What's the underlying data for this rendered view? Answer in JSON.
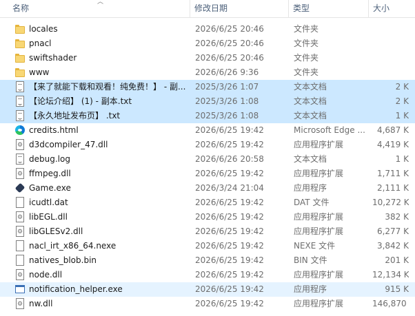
{
  "columns": {
    "name": "名称",
    "date": "修改日期",
    "type": "类型",
    "size": "大小"
  },
  "files": [
    {
      "name": "locales",
      "date": "2026/6/25 20:46",
      "type": "文件夹",
      "size": "",
      "icon": "folder-icon",
      "state": ""
    },
    {
      "name": "pnacl",
      "date": "2026/6/25 20:46",
      "type": "文件夹",
      "size": "",
      "icon": "folder-icon",
      "state": ""
    },
    {
      "name": "swiftshader",
      "date": "2026/6/25 20:46",
      "type": "文件夹",
      "size": "",
      "icon": "folder-icon",
      "state": ""
    },
    {
      "name": "www",
      "date": "2026/6/26 9:36",
      "type": "文件夹",
      "size": "",
      "icon": "folder-icon",
      "state": ""
    },
    {
      "name": "【来了就能下载和观看！纯免费！】 - 副...",
      "date": "2025/3/26 1:07",
      "type": "文本文档",
      "size": "2 K",
      "icon": "text-file-icon",
      "state": "selected"
    },
    {
      "name": "【论坛介绍】 (1) - 副本.txt",
      "date": "2025/3/26 1:08",
      "type": "文本文档",
      "size": "2 K",
      "icon": "text-file-icon",
      "state": "selected"
    },
    {
      "name": "【永久地址发布页】 .txt",
      "date": "2025/3/26 1:08",
      "type": "文本文档",
      "size": "1 K",
      "icon": "text-file-icon",
      "state": "selected"
    },
    {
      "name": "credits.html",
      "date": "2026/6/25 19:42",
      "type": "Microsoft Edge ...",
      "size": "4,687 K",
      "icon": "edge-icon",
      "state": ""
    },
    {
      "name": "d3dcompiler_47.dll",
      "date": "2026/6/25 19:42",
      "type": "应用程序扩展",
      "size": "4,419 K",
      "icon": "dll-icon",
      "state": ""
    },
    {
      "name": "debug.log",
      "date": "2026/6/26 20:58",
      "type": "文本文档",
      "size": "1 K",
      "icon": "text-file-icon",
      "state": ""
    },
    {
      "name": "ffmpeg.dll",
      "date": "2026/6/25 19:42",
      "type": "应用程序扩展",
      "size": "1,711 K",
      "icon": "dll-icon",
      "state": ""
    },
    {
      "name": "Game.exe",
      "date": "2026/3/24 21:04",
      "type": "应用程序",
      "size": "2,111 K",
      "icon": "game-exe-icon",
      "state": ""
    },
    {
      "name": "icudtl.dat",
      "date": "2026/6/25 19:42",
      "type": "DAT 文件",
      "size": "10,272 K",
      "icon": "file-icon",
      "state": ""
    },
    {
      "name": "libEGL.dll",
      "date": "2026/6/25 19:42",
      "type": "应用程序扩展",
      "size": "382 K",
      "icon": "dll-icon",
      "state": ""
    },
    {
      "name": "libGLESv2.dll",
      "date": "2026/6/25 19:42",
      "type": "应用程序扩展",
      "size": "6,277 K",
      "icon": "dll-icon",
      "state": ""
    },
    {
      "name": "nacl_irt_x86_64.nexe",
      "date": "2026/6/25 19:42",
      "type": "NEXE 文件",
      "size": "3,842 K",
      "icon": "file-icon",
      "state": ""
    },
    {
      "name": "natives_blob.bin",
      "date": "2026/6/25 19:42",
      "type": "BIN 文件",
      "size": "201 K",
      "icon": "file-icon",
      "state": ""
    },
    {
      "name": "node.dll",
      "date": "2026/6/25 19:42",
      "type": "应用程序扩展",
      "size": "12,134 K",
      "icon": "dll-icon",
      "state": ""
    },
    {
      "name": "notification_helper.exe",
      "date": "2026/6/25 19:42",
      "type": "应用程序",
      "size": "915 K",
      "icon": "app-exe-icon",
      "state": "hover"
    },
    {
      "name": "nw.dll",
      "date": "2026/6/25 19:42",
      "type": "应用程序扩展",
      "size": "146,870 K",
      "icon": "dll-icon",
      "state": ""
    }
  ],
  "colors": {
    "selected_row": "#cce8ff",
    "hover_row": "#e5f3ff",
    "header_text": "#4c607a"
  }
}
